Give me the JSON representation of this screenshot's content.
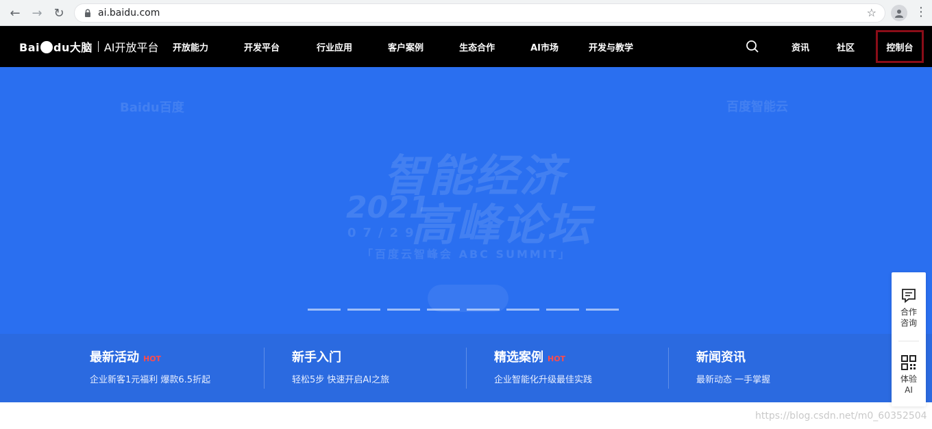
{
  "browser": {
    "url": "ai.baidu.com"
  },
  "site": {
    "logo": {
      "brand": "Bai",
      "brand_suffix": "du大脑",
      "platform": "AI开放平台"
    },
    "menu": [
      {
        "label": "开放能力"
      },
      {
        "label": "开发平台"
      },
      {
        "label": "行业应用"
      },
      {
        "label": "客户案例"
      },
      {
        "label": "生态合作"
      },
      {
        "label": "AI市场"
      },
      {
        "label": "开发与教学"
      }
    ],
    "right": {
      "news": "资讯",
      "community": "社区",
      "console": "控制台"
    }
  },
  "hero": {
    "watermark_left": "Baidu百度",
    "watermark_right": "百度智能云",
    "title1": "智能经济",
    "year": "2021",
    "title2": "高峰论坛",
    "date": "07/29",
    "summit": "「百度云智峰会 ABC SUMMIT」",
    "dots_count": 8
  },
  "features": [
    {
      "title": "最新活动",
      "hot": "HOT",
      "sub": "企业新客1元福利 爆款6.5折起"
    },
    {
      "title": "新手入门",
      "hot": "",
      "sub": "轻松5步 快速开启AI之旅"
    },
    {
      "title": "精选案例",
      "hot": "HOT",
      "sub": "企业智能化升级最佳实践"
    },
    {
      "title": "新闻资讯",
      "hot": "",
      "sub": "最新动态 一手掌握"
    }
  ],
  "side_widget": {
    "consult_line1": "合作",
    "consult_line2": "咨询",
    "try_line1": "体验",
    "try_line2": "AI"
  },
  "footer": {
    "watermark": "https://blog.csdn.net/m0_60352504"
  },
  "colors": {
    "hero_bg": "#2a6ff0",
    "strip_bg": "#2b6ae0",
    "nav_bg": "#000000",
    "console_border": "#8b0d18",
    "hot": "#ff4b4b"
  }
}
